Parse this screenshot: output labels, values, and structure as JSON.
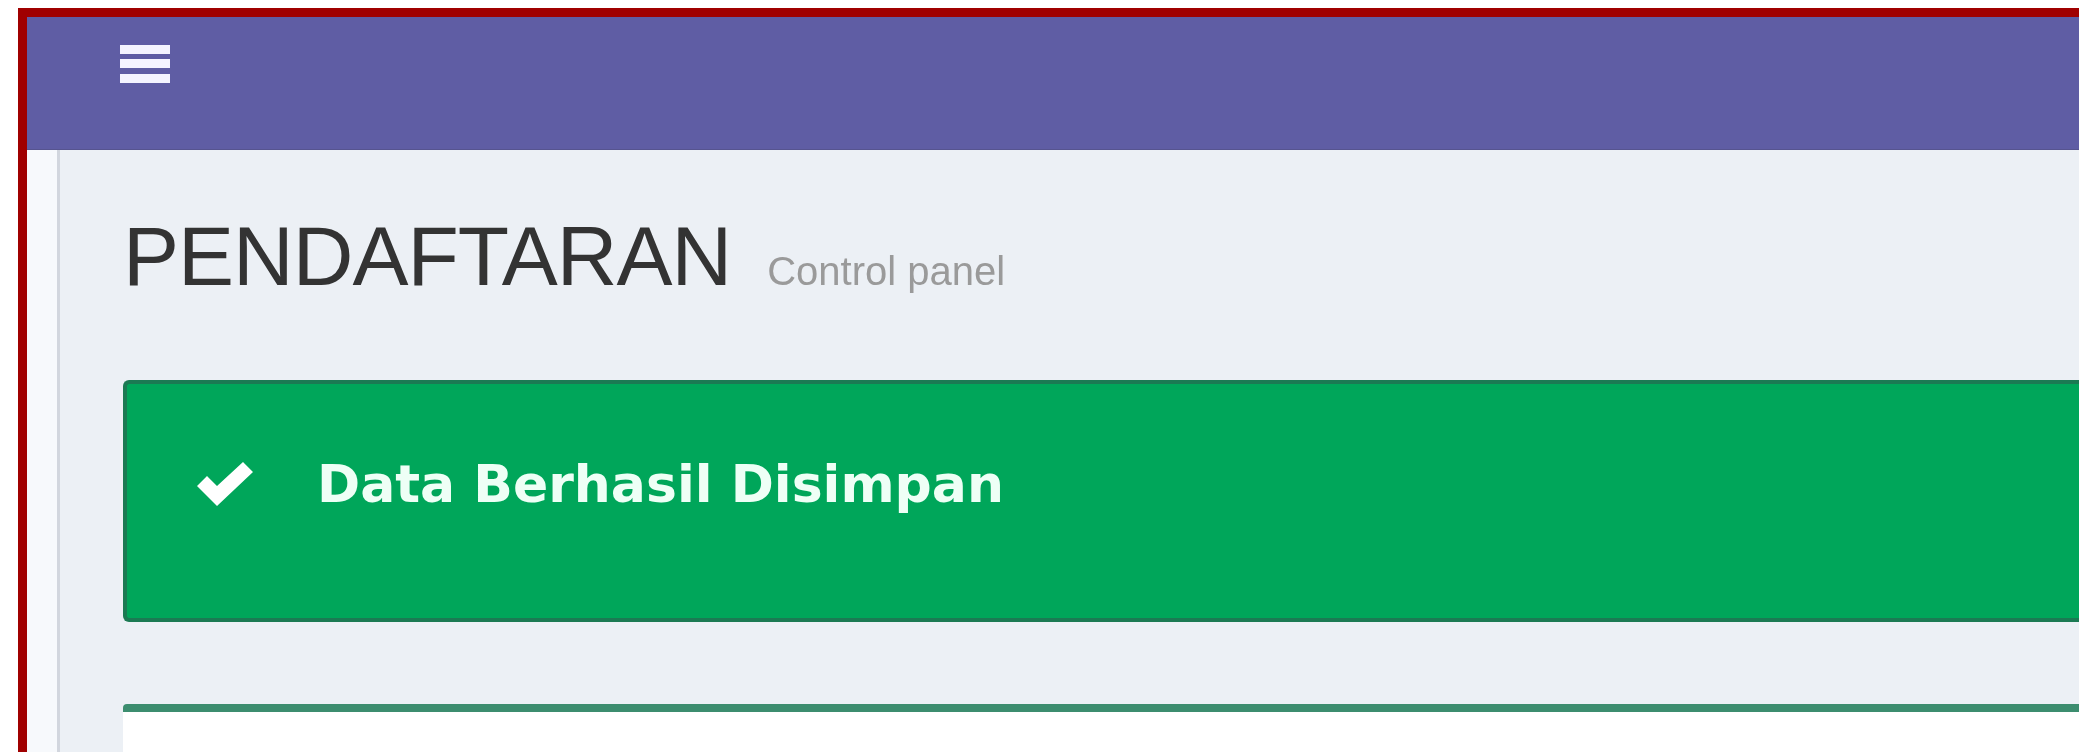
{
  "content_header": {
    "title": "PENDAFTARAN",
    "subtitle": "Control panel"
  },
  "alert": {
    "kind": "success",
    "message": "Data Berhasil Disimpan"
  }
}
